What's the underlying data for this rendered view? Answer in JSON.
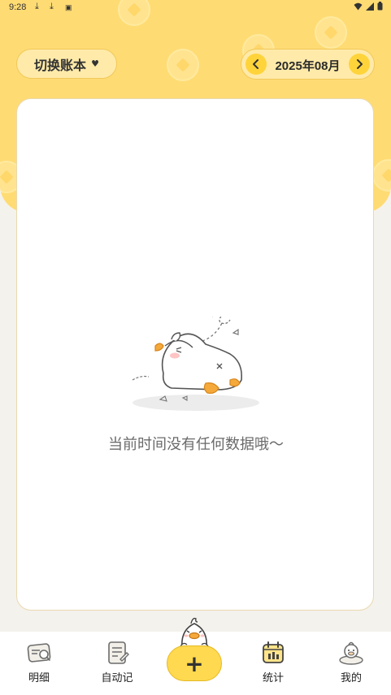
{
  "status_bar": {
    "time": "9:28",
    "icons": [
      "download-icon",
      "download-icon",
      "app-icon",
      "wifi-icon",
      "signal-icon",
      "battery-icon"
    ]
  },
  "header": {
    "ledger_switch_label": "切换账本",
    "month_label": "2025年08月",
    "accent_color": "#ffdb74"
  },
  "main": {
    "empty_message": "当前时间没有任何数据哦～"
  },
  "tabs": [
    {
      "label": "明细",
      "icon": "wallet-icon"
    },
    {
      "label": "自动记",
      "icon": "notebook-icon"
    },
    {
      "label": "统计",
      "icon": "calendar-chart-icon"
    },
    {
      "label": "我的",
      "icon": "duck-profile-icon"
    }
  ],
  "add_button": {
    "symbol": "+"
  }
}
